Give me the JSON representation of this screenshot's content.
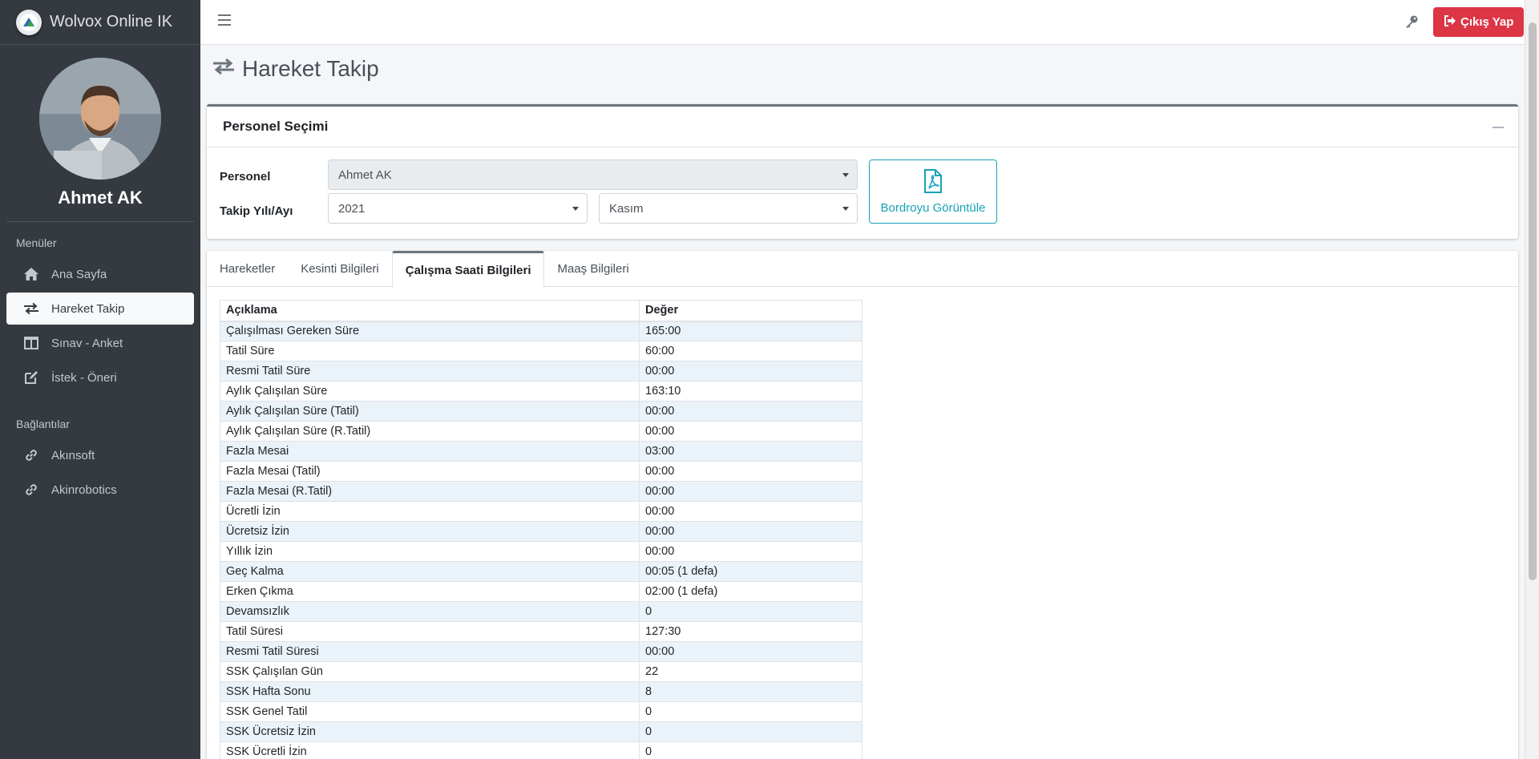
{
  "brand": {
    "name": "Wolvox Online IK"
  },
  "user": {
    "name": "Ahmet AK"
  },
  "sidebar": {
    "menu_header": "Menüler",
    "menu_items": [
      {
        "label": "Ana Sayfa",
        "icon": "home-icon"
      },
      {
        "label": "Hareket Takip",
        "icon": "exchange-icon",
        "active": true
      },
      {
        "label": "Sınav - Anket",
        "icon": "columns-icon"
      },
      {
        "label": "İstek - Öneri",
        "icon": "edit-icon"
      }
    ],
    "links_header": "Bağlantılar",
    "link_items": [
      {
        "label": "Akınsoft",
        "icon": "link-icon"
      },
      {
        "label": "Akinrobotics",
        "icon": "link-icon"
      }
    ]
  },
  "topbar": {
    "logout_label": "Çıkış Yap"
  },
  "page": {
    "title": "Hareket Takip"
  },
  "selection_card": {
    "title": "Personel Seçimi",
    "personel_label": "Personel",
    "personel_value": "Ahmet AK",
    "period_label": "Takip Yılı/Ayı",
    "year_value": "2021",
    "month_value": "Kasım",
    "payroll_button": "Bordroyu Görüntüle"
  },
  "tabs": [
    "Hareketler",
    "Kesinti Bilgileri",
    "Çalışma Saati Bilgileri",
    "Maaş Bilgileri"
  ],
  "active_tab": "Çalışma Saati Bilgileri",
  "table": {
    "headers": [
      "Açıklama",
      "Değer"
    ],
    "rows": [
      [
        "Çalışılması Gereken Süre",
        "165:00"
      ],
      [
        "Tatil Süre",
        "60:00"
      ],
      [
        "Resmi Tatil Süre",
        "00:00"
      ],
      [
        "Aylık Çalışılan Süre",
        "163:10"
      ],
      [
        "Aylık Çalışılan Süre (Tatil)",
        "00:00"
      ],
      [
        "Aylık Çalışılan Süre (R.Tatil)",
        "00:00"
      ],
      [
        "Fazla Mesai",
        "03:00"
      ],
      [
        "Fazla Mesai (Tatil)",
        "00:00"
      ],
      [
        "Fazla Mesai (R.Tatil)",
        "00:00"
      ],
      [
        "Ücretli İzin",
        "00:00"
      ],
      [
        "Ücretsiz İzin",
        "00:00"
      ],
      [
        "Yıllık İzin",
        "00:00"
      ],
      [
        "Geç Kalma",
        "00:05 (1 defa)"
      ],
      [
        "Erken Çıkma",
        "02:00 (1 defa)"
      ],
      [
        "Devamsızlık",
        "0"
      ],
      [
        "Tatil Süresi",
        "127:30"
      ],
      [
        "Resmi Tatil Süresi",
        "00:00"
      ],
      [
        "SSK Çalışılan Gün",
        "22"
      ],
      [
        "SSK Hafta Sonu",
        "8"
      ],
      [
        "SSK Genel Tatil",
        "0"
      ],
      [
        "SSK Ücretsiz İzin",
        "0"
      ],
      [
        "SSK Ücretli İzin",
        "0"
      ]
    ]
  },
  "colors": {
    "sidebar_bg": "#343a40",
    "logout": "#dc3545",
    "pdf_button": "#17a2b8",
    "row_stripe": "#eaf3fa"
  }
}
